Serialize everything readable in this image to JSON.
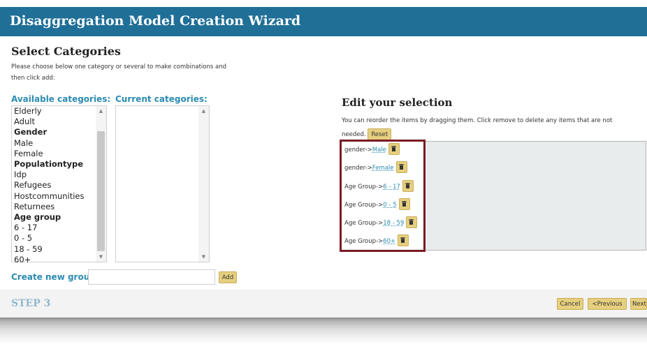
{
  "window": {
    "title": "Disaggregation Model Creation Wizard"
  },
  "section": {
    "title": "Select Categories",
    "instructions": "Please choose below one category or several to make combinations and then click add:"
  },
  "available": {
    "label": "Available categories:",
    "items": [
      {
        "text": "Elderly",
        "group": false
      },
      {
        "text": "Adult",
        "group": false
      },
      {
        "text": "Gender",
        "group": true
      },
      {
        "text": "Male",
        "group": false
      },
      {
        "text": "Female",
        "group": false
      },
      {
        "text": "Populationtype",
        "group": true
      },
      {
        "text": "Idp",
        "group": false
      },
      {
        "text": "Refugees",
        "group": false
      },
      {
        "text": "Hostcommunities",
        "group": false
      },
      {
        "text": "Returnees",
        "group": false
      },
      {
        "text": "Age group",
        "group": true
      },
      {
        "text": "6 - 17",
        "group": false
      },
      {
        "text": "0 - 5",
        "group": false
      },
      {
        "text": "18 - 59",
        "group": false
      },
      {
        "text": "60+",
        "group": false
      }
    ]
  },
  "current": {
    "label": "Current categories:",
    "items": []
  },
  "new_group": {
    "label": "Create new group:",
    "value": "",
    "add_label": "Add"
  },
  "edit": {
    "title": "Edit your selection",
    "instructions": "You can reorder the items by dragging them. Click remove to delete any items that are not needed.",
    "reset_label": "Reset",
    "items": [
      {
        "prefix": "gender->",
        "value": "Male"
      },
      {
        "prefix": "gender->",
        "value": "Female"
      },
      {
        "prefix": "Age Group->",
        "value": "6 - 17"
      },
      {
        "prefix": "Age Group->",
        "value": "0 - 5"
      },
      {
        "prefix": "Age Group->",
        "value": "18 - 59"
      },
      {
        "prefix": "Age Group->",
        "value": "60+"
      }
    ]
  },
  "footer": {
    "step": "STEP 3",
    "cancel_label": "Cancel",
    "previous_label": "<Previous",
    "next_label": "Next"
  },
  "icons": {
    "remove": "trash-icon",
    "scroll_up": "scroll-up-arrow-icon",
    "scroll_down": "scroll-down-arrow-icon"
  },
  "colors": {
    "header": "#1f6f97",
    "accent": "#2b8bb0",
    "button": "#e6cf7e",
    "highlight_border": "#7a1a24",
    "step": "#8fb8cc"
  }
}
